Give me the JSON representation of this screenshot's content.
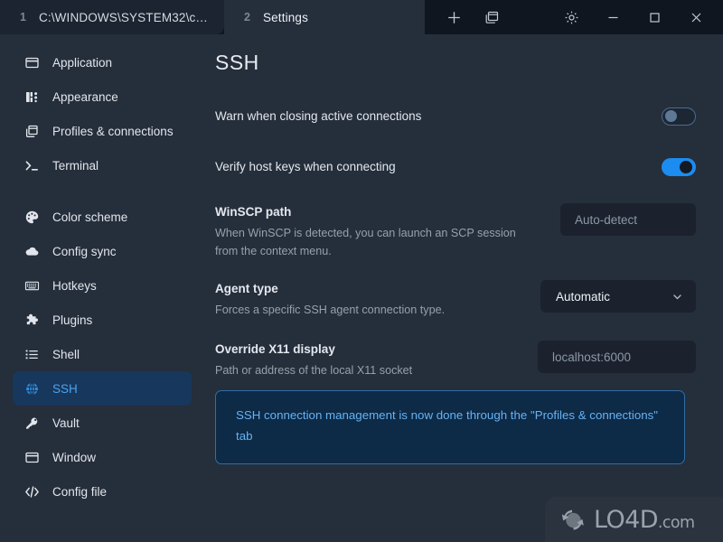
{
  "window": {
    "tabs": [
      {
        "number": "1",
        "label": "C:\\WINDOWS\\SYSTEM32\\c…",
        "active": false
      },
      {
        "number": "2",
        "label": "Settings",
        "active": true
      }
    ],
    "toolbar_left": [
      {
        "name": "new-tab-icon",
        "label": "+"
      },
      {
        "name": "split-panes-icon",
        "label": "panes"
      }
    ],
    "toolbar_right": [
      {
        "name": "settings-gear-icon",
        "label": "gear"
      },
      {
        "name": "minimize-icon",
        "label": "minimize"
      },
      {
        "name": "maximize-icon",
        "label": "maximize"
      },
      {
        "name": "close-icon",
        "label": "close"
      }
    ]
  },
  "sidebar": {
    "items": [
      {
        "label": "Application",
        "icon": "application-window-icon",
        "selected": false
      },
      {
        "label": "Appearance",
        "icon": "appearance-palette-icon",
        "selected": false
      },
      {
        "label": "Profiles & connections",
        "icon": "profiles-copy-icon",
        "selected": false
      },
      {
        "label": "Terminal",
        "icon": "terminal-prompt-icon",
        "selected": false
      },
      {
        "label": "Color scheme",
        "icon": "color-scheme-palette-icon",
        "selected": false
      },
      {
        "label": "Config sync",
        "icon": "cloud-icon",
        "selected": false
      },
      {
        "label": "Hotkeys",
        "icon": "keyboard-icon",
        "selected": false
      },
      {
        "label": "Plugins",
        "icon": "puzzle-piece-icon",
        "selected": false
      },
      {
        "label": "Shell",
        "icon": "list-icon",
        "selected": false
      },
      {
        "label": "SSH",
        "icon": "globe-icon",
        "selected": true
      },
      {
        "label": "Vault",
        "icon": "key-icon",
        "selected": false
      },
      {
        "label": "Window",
        "icon": "window-icon",
        "selected": false
      },
      {
        "label": "Config file",
        "icon": "code-brackets-icon",
        "selected": false
      }
    ]
  },
  "main": {
    "page_title": "SSH",
    "settings": {
      "warn_closing": {
        "label": "Warn when closing active connections",
        "toggle_state": "off"
      },
      "verify_host_keys": {
        "label": "Verify host keys when connecting",
        "toggle_state": "on"
      },
      "winscp_path": {
        "label": "WinSCP path",
        "description": "When WinSCP is detected, you can launch an SCP session from the context menu.",
        "placeholder": "Auto-detect",
        "value": ""
      },
      "agent_type": {
        "label": "Agent type",
        "description": "Forces a specific SSH agent connection type.",
        "selected": "Automatic"
      },
      "override_x11": {
        "label": "Override X11 display",
        "description": "Path or address of the local X11 socket",
        "placeholder": "localhost:6000",
        "value": ""
      }
    },
    "banner": {
      "text": "SSH connection management is now done through the \"Profiles & connections\" tab"
    }
  },
  "watermark": {
    "name": "LO4D",
    "suffix": ".com"
  }
}
